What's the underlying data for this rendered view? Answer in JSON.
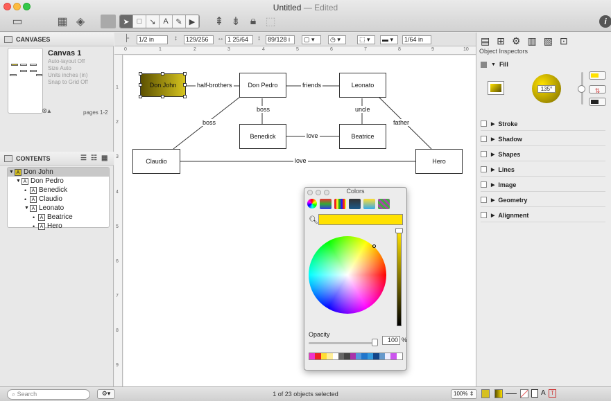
{
  "window": {
    "title": "Untitled",
    "edited": "— Edited"
  },
  "left": {
    "canvases_header": "CANVASES",
    "canvas_name": "Canvas 1",
    "canvas_info": [
      "Auto-layout Off",
      "Size Auto",
      "Units inches (in)",
      "Snap to Grid Off"
    ],
    "pages": "pages 1-2",
    "contents_header": "CONTENTS",
    "outline": [
      {
        "label": "Don John",
        "level": 0,
        "kind": "tri"
      },
      {
        "label": "Don Pedro",
        "level": 1,
        "kind": "tri"
      },
      {
        "label": "Benedick",
        "level": 2,
        "kind": "bullet"
      },
      {
        "label": "Claudio",
        "level": 2,
        "kind": "bullet"
      },
      {
        "label": "Leonato",
        "level": 2,
        "kind": "tri"
      },
      {
        "label": "Beatrice",
        "level": 3,
        "kind": "bullet"
      },
      {
        "label": "Hero",
        "level": 3,
        "kind": "bullet"
      }
    ]
  },
  "format": {
    "line_width": "1/2 in",
    "f1": "129/256",
    "f2": "1 25/64",
    "f3": "89/128 i",
    "f4": "1/64 in"
  },
  "ruler": [
    "0",
    "1",
    "2",
    "3",
    "4",
    "5",
    "6",
    "7",
    "8",
    "9",
    "10"
  ],
  "ruler_v": [
    "1",
    "2",
    "3",
    "4",
    "5",
    "6",
    "7",
    "8",
    "9"
  ],
  "diagram": {
    "nodes": {
      "don_john": "Don John",
      "don_pedro": "Don Pedro",
      "leonato": "Leonato",
      "benedick": "Benedick",
      "beatrice": "Beatrice",
      "claudio": "Claudio",
      "hero": "Hero"
    },
    "edges": {
      "half_brothers": "half-brothers",
      "friends": "friends",
      "boss1": "boss",
      "uncle": "uncle",
      "boss2": "boss",
      "father": "father",
      "love1": "love",
      "love2": "love"
    }
  },
  "colors": {
    "title": "Colors",
    "opacity_label": "Opacity",
    "opacity_value": "100",
    "pct": "%",
    "current": "#ffe100"
  },
  "inspector": {
    "header": "Object Inspectors",
    "fill": "Fill",
    "angle": "135°",
    "sections": [
      "Stroke",
      "Shadow",
      "Shapes",
      "Lines",
      "Image",
      "Geometry",
      "Alignment"
    ]
  },
  "status": {
    "search_placeholder": "Search",
    "selection": "1 of 23 objects selected",
    "zoom": "100%"
  }
}
